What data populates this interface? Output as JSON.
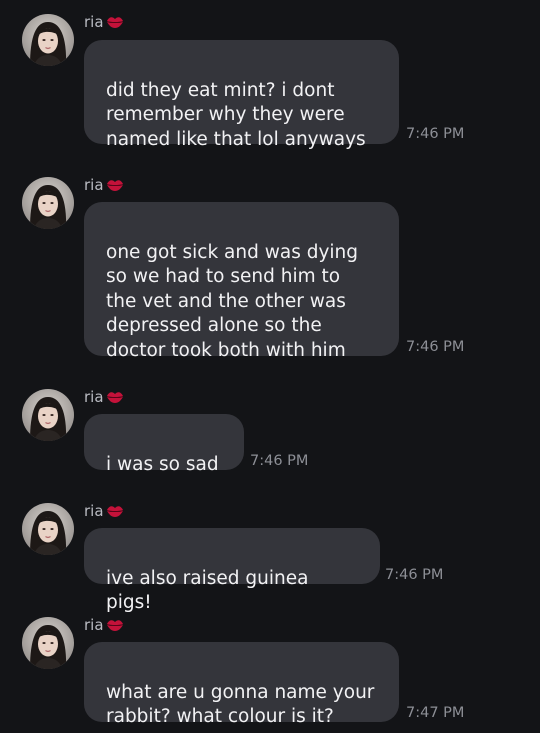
{
  "sender": "ria",
  "sender_badge_icon": "lips-icon",
  "colors": {
    "background": "#131417",
    "bubble": "#34353b",
    "text": "#f2f2f4",
    "meta": "#8d8f96",
    "lips": "#c4123a"
  },
  "messages": [
    {
      "text": "did they eat mint? i dont\nremember why they were\nnamed like that lol anyways",
      "time": "7:46 PM"
    },
    {
      "text": "one got sick and was dying\nso we had to send him to\nthe vet and the other was\ndepressed alone so the\ndoctor took both with him",
      "time": "7:46 PM"
    },
    {
      "text": "i was so sad",
      "time": "7:46 PM"
    },
    {
      "text": "ive also raised guinea pigs!",
      "time": "7:46 PM"
    },
    {
      "text": "what are u gonna name your\nrabbit? what colour is it?",
      "time": "7:47 PM"
    }
  ]
}
